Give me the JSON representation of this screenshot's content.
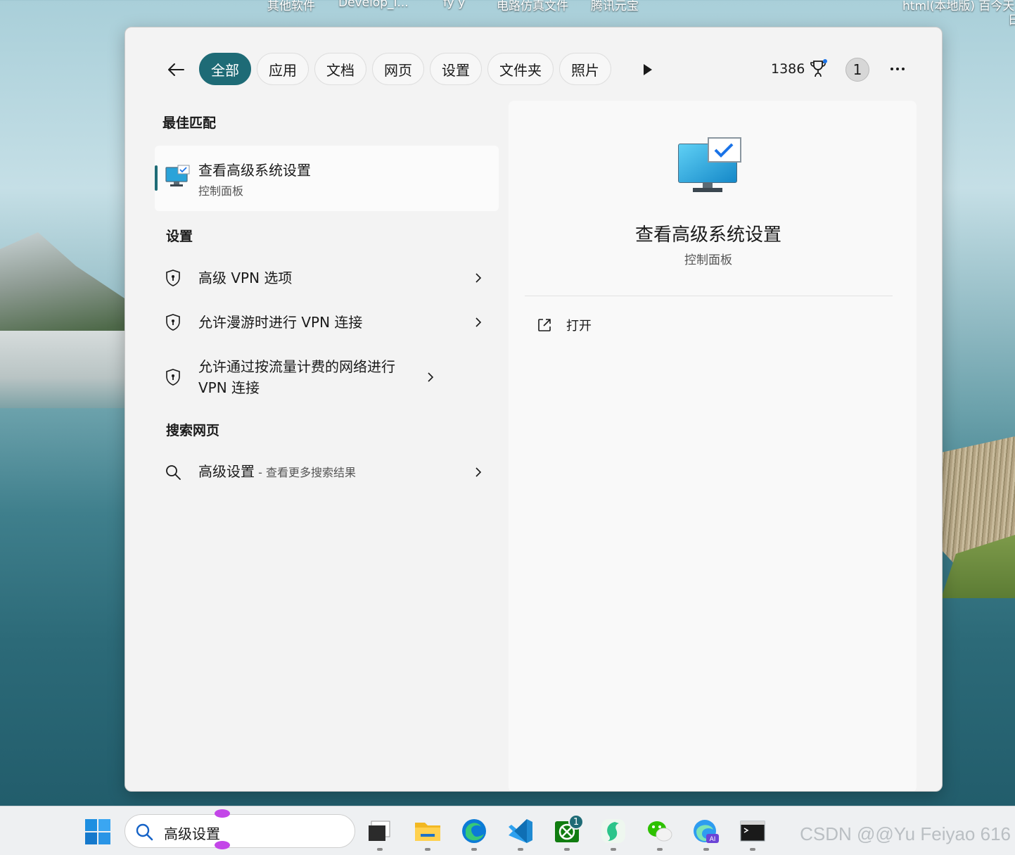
{
  "desktop": {
    "labels": [
      "其他软件",
      "Develop_I...",
      "fy y",
      "电路仿真文件",
      "腾讯元宝",
      "html(本地版) 百今天",
      "日"
    ]
  },
  "search_panel": {
    "filters": [
      {
        "label": "全部",
        "active": true
      },
      {
        "label": "应用"
      },
      {
        "label": "文档"
      },
      {
        "label": "网页"
      },
      {
        "label": "设置"
      },
      {
        "label": "文件夹"
      },
      {
        "label": "照片"
      }
    ],
    "points": "1386",
    "avatar_initial": "1",
    "best_match": {
      "heading": "最佳匹配",
      "title": "查看高级系统设置",
      "subtitle": "控制面板"
    },
    "settings": {
      "heading": "设置",
      "items": [
        {
          "label": "高级 VPN 选项"
        },
        {
          "label": "允许漫游时进行 VPN 连接"
        },
        {
          "label": "允许通过按流量计费的网络进行 VPN 连接"
        }
      ]
    },
    "web": {
      "heading": "搜索网页",
      "query": "高级设置",
      "hint": " - 查看更多搜索结果"
    },
    "preview": {
      "title": "查看高级系统设置",
      "subtitle": "控制面板",
      "open_label": "打开"
    }
  },
  "taskbar": {
    "search_value": "高级设置",
    "xbox_badge": "1",
    "apps": [
      "task-view",
      "file-explorer",
      "edge",
      "vscode",
      "xbox",
      "lingxi",
      "wechat",
      "edge-ai",
      "terminal"
    ]
  },
  "watermark": "CSDN @@Yu Feiyao 616",
  "colors": {
    "accent": "#1e6b76",
    "panel_bg": "#f3f3f3",
    "preview_bg": "#f9f9f9"
  }
}
